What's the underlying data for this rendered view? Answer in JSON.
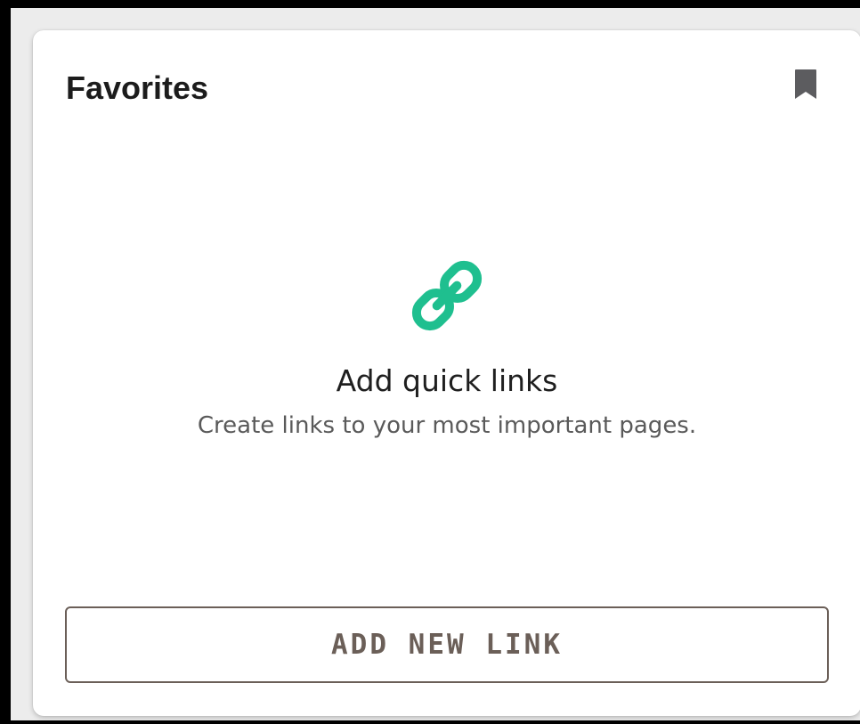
{
  "card": {
    "title": "Favorites",
    "header_icon": "bookmark-icon"
  },
  "empty_state": {
    "icon": "link-icon",
    "title": "Add quick links",
    "subtitle": "Create links to your most important pages."
  },
  "actions": {
    "add_link_label": "ADD NEW LINK"
  },
  "colors": {
    "accent": "#1fbf8f",
    "button_border": "#6b5f58",
    "title_text": "#1c1c1c"
  }
}
